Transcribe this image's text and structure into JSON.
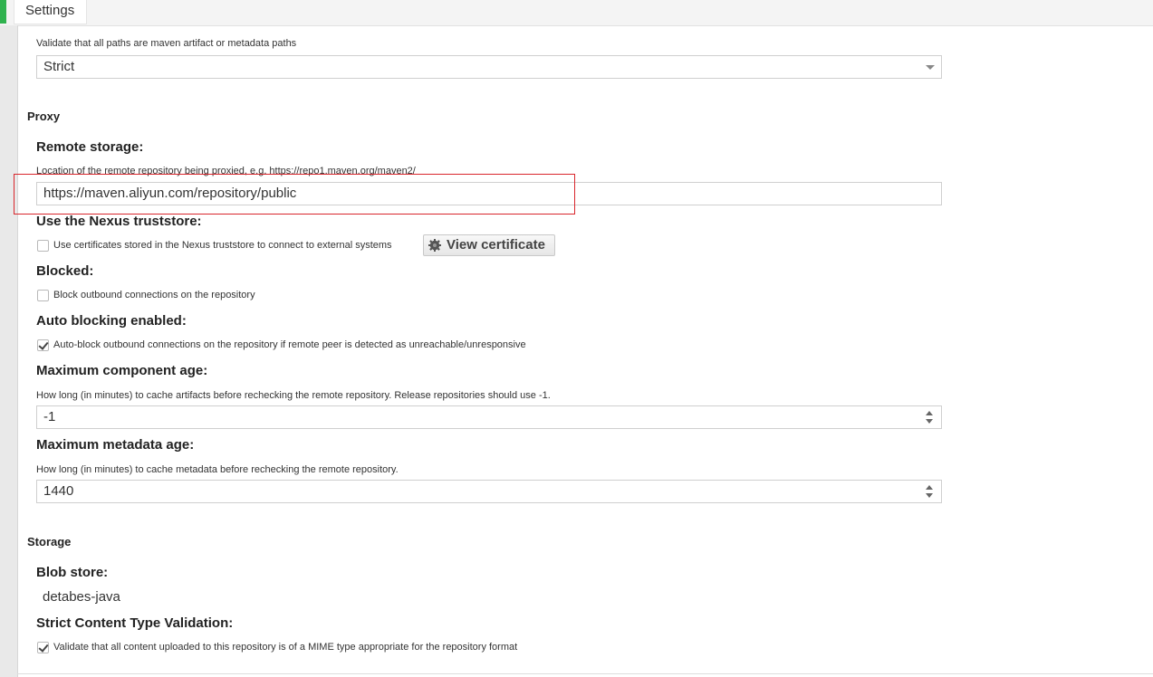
{
  "header": {
    "tab_label": "Settings"
  },
  "validation": {
    "hint": "Validate that all paths are maven artifact or metadata paths",
    "value": "Strict"
  },
  "proxy": {
    "section_title": "Proxy",
    "remote_storage": {
      "label": "Remote storage:",
      "hint": "Location of the remote repository being proxied, e.g. https://repo1.maven.org/maven2/",
      "value": "https://maven.aliyun.com/repository/public"
    },
    "truststore": {
      "label": "Use the Nexus truststore:",
      "checkbox_text": "Use certificates stored in the Nexus truststore to connect to external systems",
      "checked": false,
      "button_label": "View certificate"
    },
    "blocked": {
      "label": "Blocked:",
      "checkbox_text": "Block outbound connections on the repository",
      "checked": false
    },
    "auto_blocking": {
      "label": "Auto blocking enabled:",
      "checkbox_text": "Auto-block outbound connections on the repository if remote peer is detected as unreachable/unresponsive",
      "checked": true
    },
    "max_component_age": {
      "label": "Maximum component age:",
      "hint": "How long (in minutes) to cache artifacts before rechecking the remote repository. Release repositories should use -1.",
      "value": "-1"
    },
    "max_metadata_age": {
      "label": "Maximum metadata age:",
      "hint": "How long (in minutes) to cache metadata before rechecking the remote repository.",
      "value": "1440"
    }
  },
  "storage": {
    "section_title": "Storage",
    "blob_store": {
      "label": "Blob store:",
      "value": "detabes-java"
    },
    "strict_content": {
      "label": "Strict Content Type Validation:",
      "checkbox_text": "Validate that all content uploaded to this repository is of a MIME type appropriate for the repository format",
      "checked": true
    }
  },
  "colors": {
    "accent_green": "#2fb24e",
    "highlight_red": "#d9262c"
  }
}
